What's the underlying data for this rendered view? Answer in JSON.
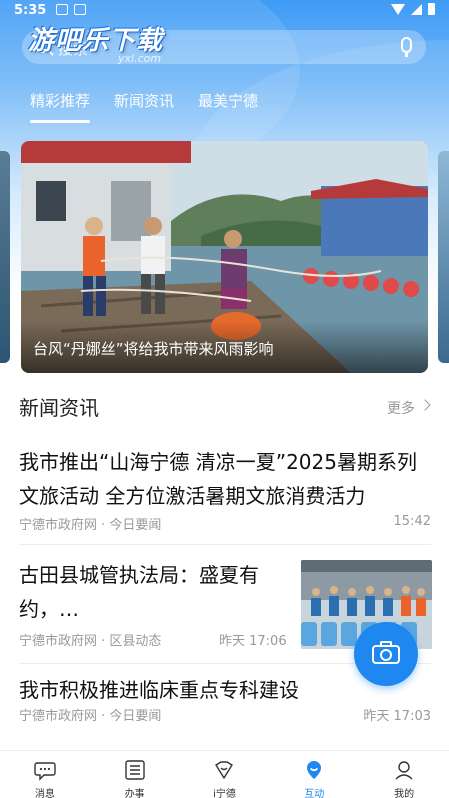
{
  "status_bar": {
    "time": "5:35"
  },
  "watermark": {
    "logo_text": "游吧乐下载",
    "logo_sub": "yxl.com"
  },
  "search": {
    "placeholder": "搜索"
  },
  "tabs": [
    {
      "label": "精彩推荐",
      "active": true
    },
    {
      "label": "新闻资讯",
      "active": false
    },
    {
      "label": "最美宁德",
      "active": false
    }
  ],
  "banner": {
    "caption": "台风“丹娜丝”将给我市带来风雨影响"
  },
  "section": {
    "title": "新闻资讯",
    "more_label": "更多"
  },
  "news": [
    {
      "title_line1": "我市推出“山海宁德 清凉一夏”2025暑期系列",
      "title_line2": "文旅活动 全方位激活暑期文旅消费活力",
      "meta": "宁德市政府网 · 今日要闻",
      "time": "15:42"
    },
    {
      "title_line1": "古田县城管执法局：盛夏有",
      "title_line2": "约，…",
      "meta": "宁德市政府网 · 区县动态",
      "time": "昨天 17:06",
      "has_thumb": true
    },
    {
      "title_line1": "我市积极推进临床重点专科建设",
      "meta": "宁德市政府网 · 今日要闻",
      "time": "昨天 17:03"
    }
  ],
  "bottom_nav": [
    {
      "label": "消息",
      "icon": "chat-icon",
      "active": false
    },
    {
      "label": "办事",
      "icon": "list-icon",
      "active": false
    },
    {
      "label": "i宁德",
      "icon": "heart-icon",
      "active": false
    },
    {
      "label": "互动",
      "icon": "location-pin-icon",
      "active": true
    },
    {
      "label": "我的",
      "icon": "profile-icon",
      "active": false
    }
  ],
  "colors": {
    "accent": "#1e88f0",
    "header": "#3f9bf5"
  }
}
